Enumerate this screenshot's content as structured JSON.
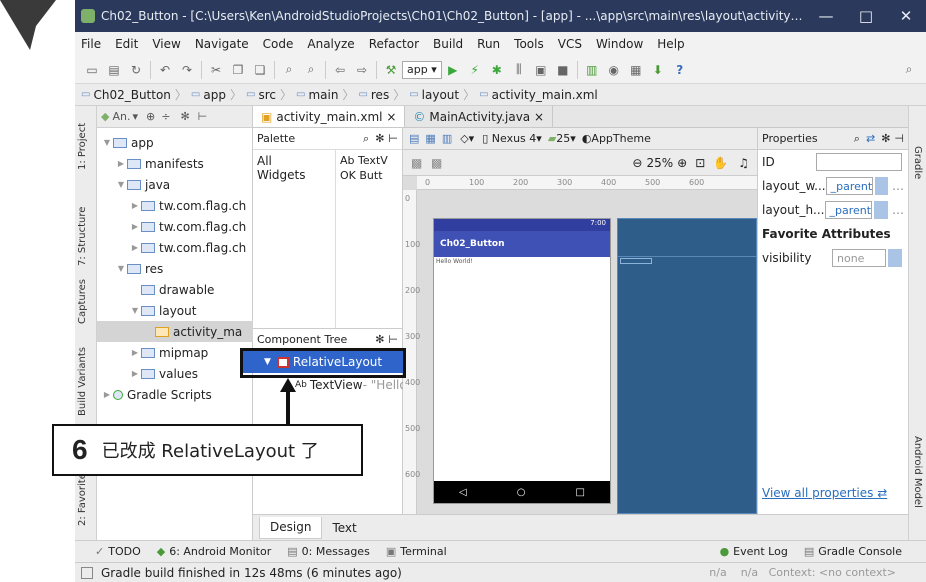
{
  "window": {
    "title": "Ch02_Button - [C:\\Users\\Ken\\AndroidStudioProjects\\Ch01\\Ch02_Button] - [app] - ...\\app\\src\\main\\res\\layout\\activity_main.xml...",
    "min": "—",
    "max": "□",
    "close": "✕"
  },
  "menu": [
    "File",
    "Edit",
    "View",
    "Navigate",
    "Code",
    "Analyze",
    "Refactor",
    "Build",
    "Run",
    "Tools",
    "VCS",
    "Window",
    "Help"
  ],
  "toolbar": {
    "app_combo": "app",
    "help": "?"
  },
  "breadcrumbs": [
    "Ch02_Button",
    "app",
    "src",
    "main",
    "res",
    "layout",
    "activity_main.xml"
  ],
  "left_tabs": [
    "1: Project",
    "7: Structure",
    "Captures",
    "Build Variants",
    "2: Favorites"
  ],
  "project_panel": {
    "header": "An."
  },
  "tree": [
    {
      "label": "app",
      "indent": 0,
      "arrow": "▼"
    },
    {
      "label": "manifests",
      "indent": 1,
      "arrow": "▶"
    },
    {
      "label": "java",
      "indent": 1,
      "arrow": "▼"
    },
    {
      "label": "tw.com.flag.ch",
      "indent": 2,
      "arrow": "▶"
    },
    {
      "label": "tw.com.flag.ch",
      "indent": 2,
      "arrow": "▶"
    },
    {
      "label": "tw.com.flag.ch",
      "indent": 2,
      "arrow": "▶"
    },
    {
      "label": "res",
      "indent": 1,
      "arrow": "▼"
    },
    {
      "label": "drawable",
      "indent": 2,
      "arrow": ""
    },
    {
      "label": "layout",
      "indent": 2,
      "arrow": "▼"
    },
    {
      "label": "activity_ma",
      "indent": 3,
      "arrow": ""
    },
    {
      "label": "mipmap",
      "indent": 2,
      "arrow": "▶"
    },
    {
      "label": "values",
      "indent": 2,
      "arrow": "▶"
    },
    {
      "label": "Gradle Scripts",
      "indent": 0,
      "arrow": "▶"
    }
  ],
  "editor_tabs": [
    {
      "label": "activity_main.xml ×",
      "active": true
    },
    {
      "label": "MainActivity.java ×",
      "active": false
    }
  ],
  "palette": {
    "title": "Palette",
    "groups": [
      "All",
      "Widgets"
    ],
    "items": [
      "Ab TextV",
      "OK Butt"
    ]
  },
  "component_tree": {
    "title": "Component Tree",
    "root": "RelativeLayout",
    "child_icon": "Ab",
    "child": "TextView",
    "child_suffix": " - \"Hello"
  },
  "design_toolbar": {
    "device": "Nexus 4",
    "api": "25",
    "theme": "AppTheme",
    "zoom": "25%"
  },
  "ruler": {
    "top": [
      "0",
      "100",
      "200",
      "300",
      "400",
      "500",
      "600"
    ],
    "left": [
      "0",
      "100",
      "200",
      "300",
      "400",
      "500",
      "600"
    ]
  },
  "phone": {
    "time": "7:00",
    "app_title": "Ch02_Button",
    "body_text": "Hello World!"
  },
  "properties": {
    "title": "Properties",
    "id_label": "ID",
    "rows": [
      {
        "label": "layout_w...",
        "value": "_parent"
      },
      {
        "label": "layout_h...",
        "value": "_parent"
      }
    ],
    "favorites": "Favorite Attributes",
    "visibility_label": "visibility",
    "visibility_value": "none",
    "view_all": "View all properties"
  },
  "right_tabs": [
    "Gradle",
    "Android Model"
  ],
  "bottom_tabs": [
    {
      "label": "Design",
      "active": true
    },
    {
      "label": "Text",
      "active": false
    }
  ],
  "tool_windows": [
    "TODO",
    "6: Android Monitor",
    "0: Messages",
    "Terminal",
    "Event Log",
    "Gradle Console"
  ],
  "status": {
    "message": "Gradle build finished in 12s 48ms (6 minutes ago)",
    "right": "n/a    n/a   Context: <no context>"
  },
  "annotation": {
    "number": "6",
    "text": "已改成 RelativeLayout 了"
  }
}
